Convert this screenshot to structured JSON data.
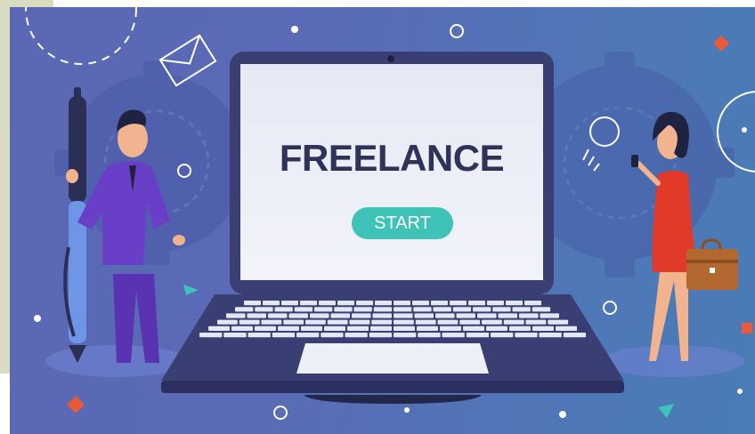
{
  "banner": {
    "headline": "FREELANCE",
    "button_label": "START"
  },
  "colors": {
    "background": "#5a6bb6",
    "laptop_frame": "#3a3f73",
    "screen": "#eceef8",
    "button": "#3fc2b7",
    "headline": "#2f3358",
    "man_suit": "#6a3fc8",
    "woman_dress": "#e23a28",
    "pen": "#6f96e6"
  },
  "icons": [
    "envelope-icon",
    "lightbulb-icon",
    "gear-icon",
    "pen-icon",
    "briefcase-icon",
    "phone-icon"
  ]
}
